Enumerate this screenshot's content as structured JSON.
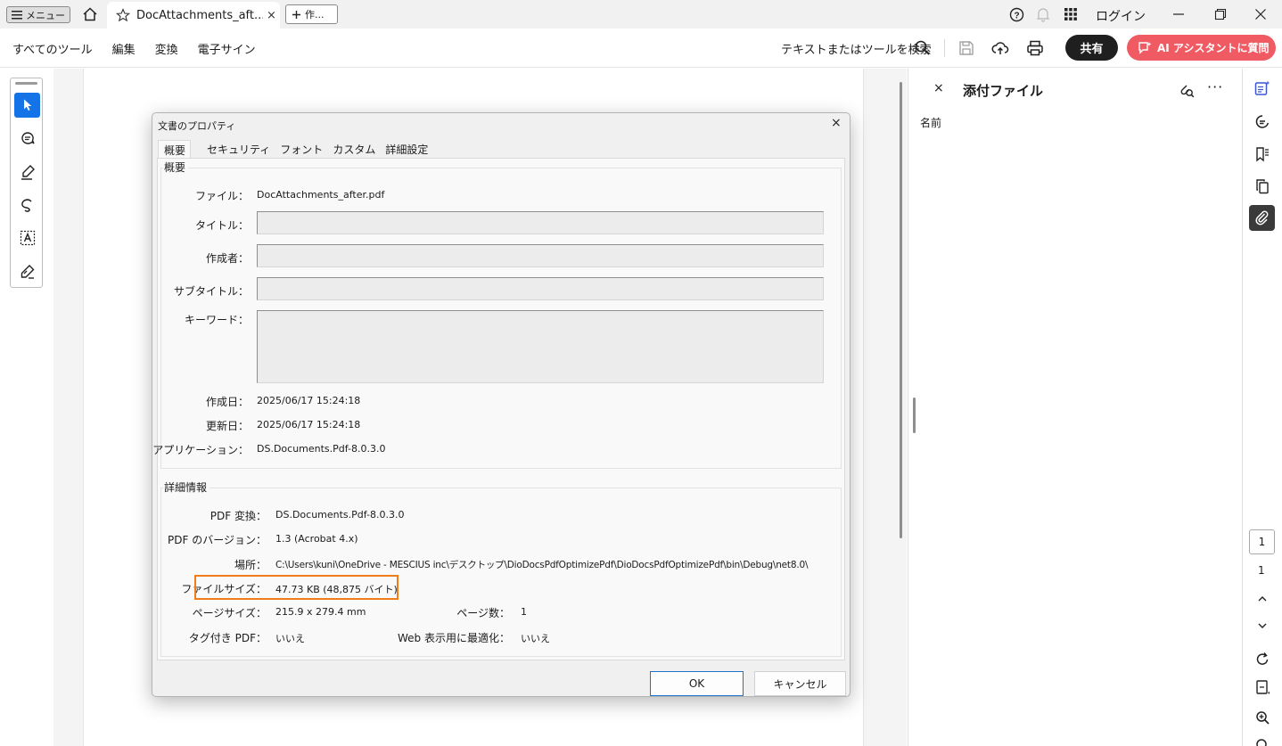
{
  "titlebar": {
    "menu_label": "メニュー",
    "tab_title": "DocAttachments_aft...",
    "tab_close": "×",
    "new_tab_label": "作...",
    "login_label": "ログイン"
  },
  "toolbar": {
    "menu_items": [
      "すべてのツール",
      "編集",
      "変換",
      "電子サイン"
    ],
    "search_label": "テキストまたはツールを検索",
    "share_label": "共有",
    "ai_label": "AI アシスタントに質問"
  },
  "panel": {
    "close": "×",
    "title": "添付ファイル",
    "more": "···",
    "name_header": "名前"
  },
  "rail": {
    "page_current": "1",
    "page_total": "1"
  },
  "dialog": {
    "title": "文書のプロパティ",
    "close": "×",
    "tabs": [
      "概要",
      "セキュリティ",
      "フォント",
      "カスタム",
      "詳細設定"
    ],
    "summary": {
      "group_label": "概要",
      "file_label": "ファイル：",
      "file_value": "DocAttachments_after.pdf",
      "title_label": "タイトル：",
      "title_value": "",
      "author_label": "作成者：",
      "author_value": "",
      "subject_label": "サブタイトル：",
      "subject_value": "",
      "keywords_label": "キーワード：",
      "keywords_value": "",
      "created_label": "作成日：",
      "created_value": "2025/06/17 15:24:18",
      "modified_label": "更新日：",
      "modified_value": "2025/06/17 15:24:18",
      "application_label": "アプリケーション：",
      "application_value": "DS.Documents.Pdf-8.0.3.0"
    },
    "details": {
      "group_label": "詳細情報",
      "producer_label": "PDF 変換：",
      "producer_value": "DS.Documents.Pdf-8.0.3.0",
      "version_label": "PDF のバージョン：",
      "version_value": "1.3 (Acrobat 4.x)",
      "location_label": "場所：",
      "location_value": "C:\\Users\\kuni\\OneDrive - MESCIUS inc\\デスクトップ\\DioDocsPdfOptimizePdf\\DioDocsPdfOptimizePdf\\bin\\Debug\\net8.0\\",
      "filesize_label": "ファイルサイズ：",
      "filesize_value": "47.73 KB (48,875 バイト)",
      "pagesize_label": "ページサイズ：",
      "pagesize_value": "215.9 x 279.4 mm",
      "pagecount_label": "ページ数：",
      "pagecount_value": "1",
      "tagged_label": "タグ付き PDF：",
      "tagged_value": "いいえ",
      "fastweb_label": "Web 表示用に最適化：",
      "fastweb_value": "いいえ"
    },
    "ok_label": "OK",
    "cancel_label": "キャンセル"
  },
  "colors": {
    "accent_blue": "#1473e6",
    "ai_red": "#ef5a63",
    "highlight_orange": "#f07d1a"
  }
}
